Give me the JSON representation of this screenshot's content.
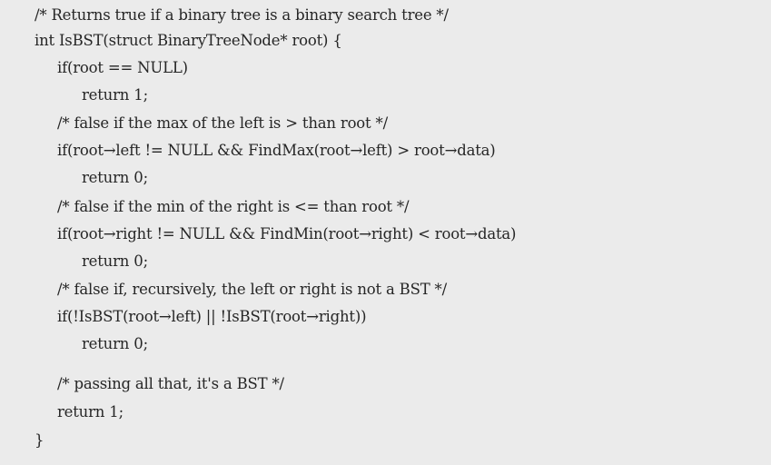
{
  "code": {
    "lines": [
      "/* Returns true if a binary tree is a binary search tree */",
      "int IsBST(struct BinaryTreeNode* root) {",
      "if(root == NULL)",
      "return 1;",
      "/* false if the max of the left is > than root */",
      "if(root→left != NULL && FindMax(root→left) > root→data)",
      "return 0;",
      "/* false if the min of the right is <= than root */",
      "if(root→right != NULL && FindMin(root→right) < root→data)",
      "return 0;",
      "/* false if, recursively, the left or right is not a BST */",
      "if(!IsBST(root→left) || !IsBST(root→right))",
      "return 0;",
      "/* passing all that, it's a BST */",
      "return 1;",
      "}"
    ]
  }
}
